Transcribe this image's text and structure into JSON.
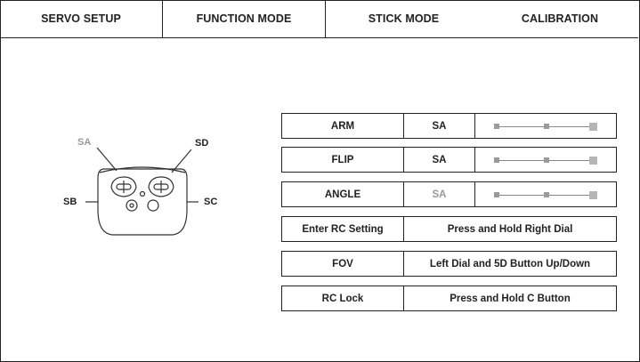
{
  "tabs": [
    {
      "label": "SERVO SETUP"
    },
    {
      "label": "FUNCTION MODE"
    },
    {
      "label": "STICK MODE"
    },
    {
      "label": "CALIBRATION"
    }
  ],
  "controller": {
    "labels": {
      "sa": "SA",
      "sd": "SD",
      "sb": "SB",
      "sc": "SC"
    }
  },
  "switch_rows": [
    {
      "name": "ARM",
      "switch": "SA",
      "switch_dimmed": false
    },
    {
      "name": "FLIP",
      "switch": "SA",
      "switch_dimmed": false
    },
    {
      "name": "ANGLE",
      "switch": "SA",
      "switch_dimmed": true
    }
  ],
  "info_rows": [
    {
      "name": "Enter RC Setting",
      "value": "Press and Hold Right Dial"
    },
    {
      "name": "FOV",
      "value": "Left Dial and 5D Button Up/Down"
    },
    {
      "name": "RC Lock",
      "value": "Press and Hold C Button"
    }
  ],
  "colors": {
    "border": "#222222",
    "dim_text": "#9a9a9a"
  }
}
